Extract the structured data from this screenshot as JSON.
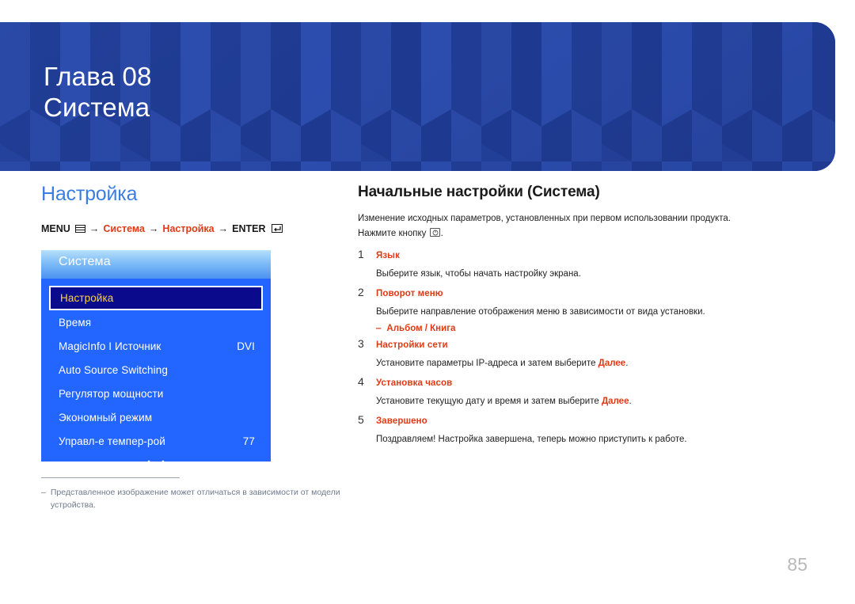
{
  "banner": {
    "chapter_label": "Глава 08",
    "chapter_title": "Система",
    "bg_color": "#23409a"
  },
  "left": {
    "section_heading": "Настройка",
    "section_heading_color": "#3b7de0",
    "menu_path": {
      "menu_label": "MENU",
      "menu_icon": "menu-grid-icon",
      "arrow": "→",
      "step1": "Система",
      "step2": "Настройка",
      "enter_label": "ENTER",
      "enter_icon": "enter-key-icon",
      "highlight_color": "#e03a15"
    },
    "osd": {
      "title": "Система",
      "items": [
        {
          "label": "Настройка",
          "value": "",
          "selected": true
        },
        {
          "label": "Время",
          "value": "",
          "selected": false
        },
        {
          "label": "MagicInfo I Источник",
          "value": "DVI",
          "selected": false
        },
        {
          "label": "Auto Source Switching",
          "value": "",
          "selected": false
        },
        {
          "label": "Регулятор мощности",
          "value": "",
          "selected": false
        },
        {
          "label": "Экономный режим",
          "value": "",
          "selected": false
        },
        {
          "label": "Управл-е темпер-рой",
          "value": "77",
          "selected": false
        }
      ],
      "scroll_icon": "chevron-down-icon",
      "selected_text_color": "#ffd23a",
      "panel_color": "#2266ff"
    },
    "footnote": {
      "dash": "‒",
      "text": "Представленное изображение может отличаться в зависимости от модели устройства."
    }
  },
  "right": {
    "title": "Начальные настройки (Система)",
    "intro_line1": "Изменение исходных параметров, установленных при первом использовании продукта.",
    "intro_line2_before": "Нажмите кнопку",
    "intro_line2_after": ".",
    "intro_icon": "power-button-icon",
    "steps": [
      {
        "num": "1",
        "title": "Язык",
        "desc": "Выберите язык, чтобы начать настройку экрана.",
        "desc_tail": "",
        "highlight": "",
        "sub_dash": "",
        "sub": ""
      },
      {
        "num": "2",
        "title": "Поворот меню",
        "desc": "Выберите направление отображения меню в зависимости от вида установки.",
        "desc_tail": "",
        "highlight": "",
        "sub_dash": "‒",
        "sub": "Альбом / Книга"
      },
      {
        "num": "3",
        "title": "Настройки сети",
        "desc": "Установите параметры IP-адреса и затем выберите ",
        "highlight": "Далее",
        "desc_tail": ".",
        "sub_dash": "",
        "sub": ""
      },
      {
        "num": "4",
        "title": "Установка часов",
        "desc": "Установите текущую дату и время и затем выберите ",
        "highlight": "Далее",
        "desc_tail": ".",
        "sub_dash": "",
        "sub": ""
      },
      {
        "num": "5",
        "title": "Завершено",
        "desc": "Поздравляем! Настройка завершена, теперь можно приступить к работе.",
        "desc_tail": "",
        "highlight": "",
        "sub_dash": "",
        "sub": ""
      }
    ],
    "accent_color": "#e03a15"
  },
  "page_number": "85"
}
